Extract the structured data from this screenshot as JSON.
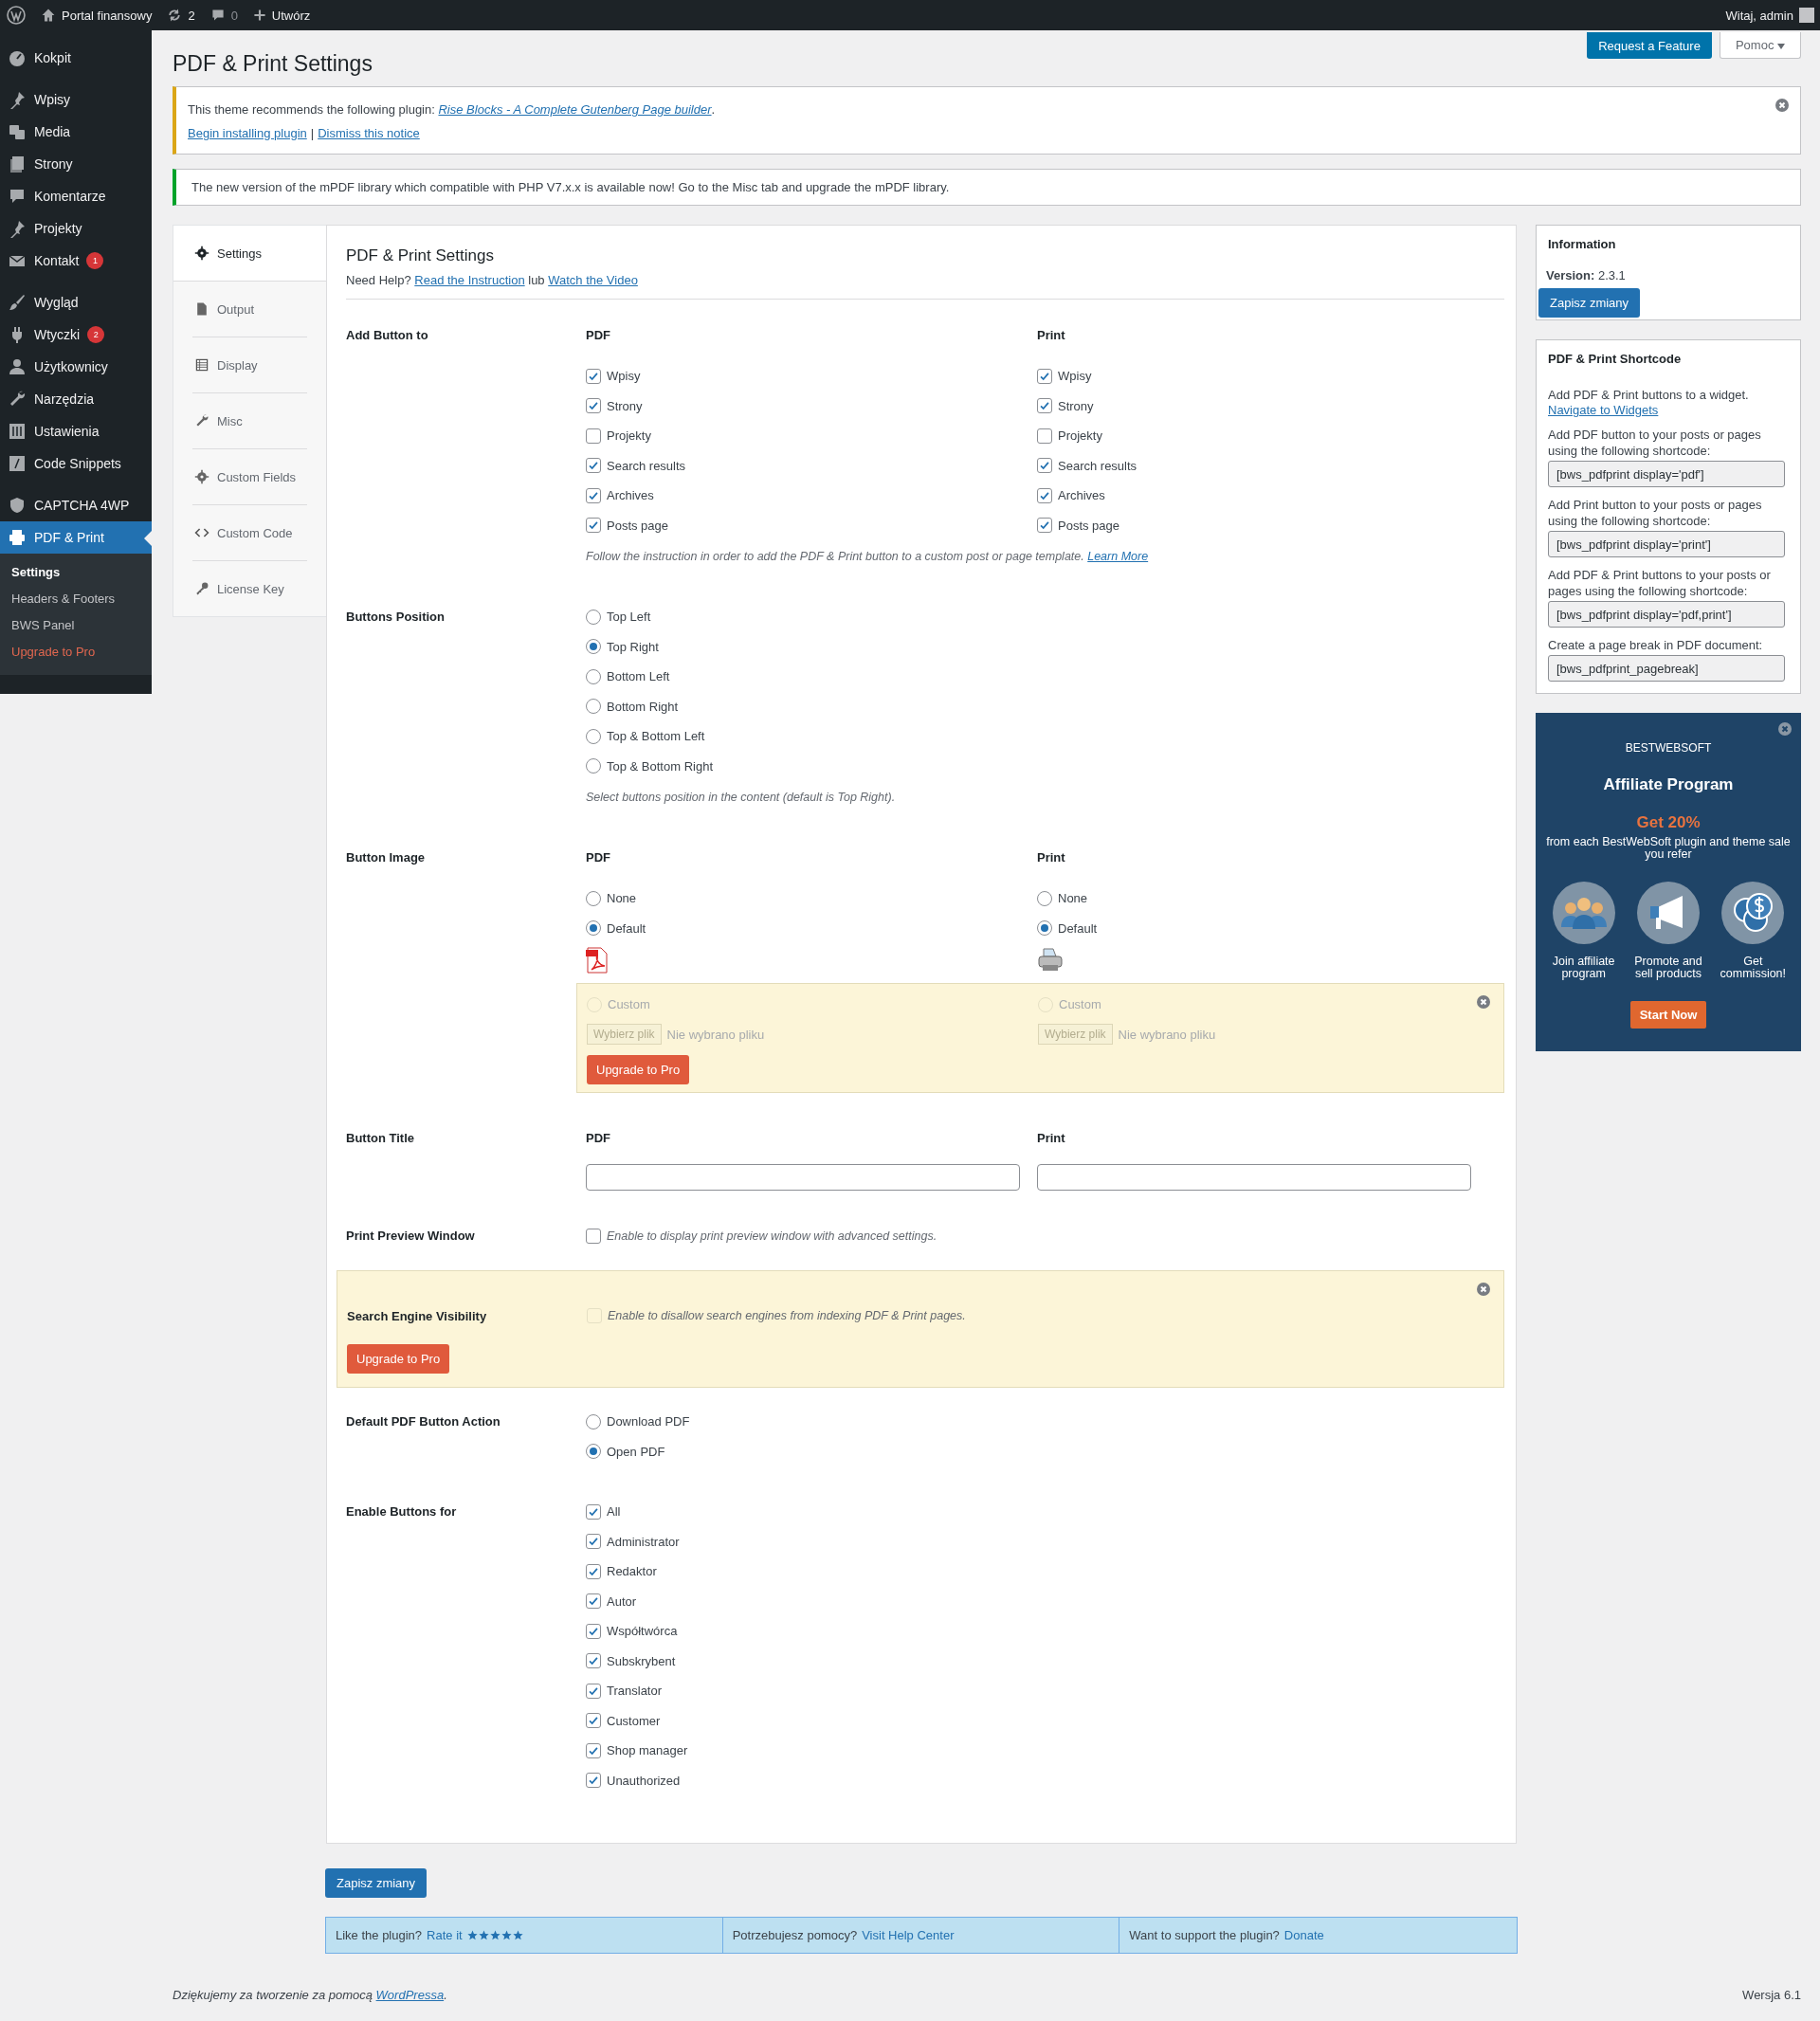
{
  "top_bar": {
    "site_name": "Portal finansowy",
    "updates": "2",
    "comments": "0",
    "new_label": "Utwórz",
    "greeting": "Witaj, admin"
  },
  "sidebar": {
    "groups": [
      {
        "items": [
          {
            "label": "Kokpit",
            "selected": false
          }
        ]
      },
      {
        "items": [
          {
            "label": "Wpisy",
            "selected": false
          },
          {
            "label": "Media",
            "selected": false
          },
          {
            "label": "Strony",
            "selected": false
          },
          {
            "label": "Komentarze",
            "selected": false
          },
          {
            "label": "Projekty",
            "selected": false
          },
          {
            "label": "Kontakt",
            "selected": false,
            "badge": "1"
          }
        ]
      },
      {
        "items": [
          {
            "label": "Wygląd",
            "selected": false
          },
          {
            "label": "Wtyczki",
            "selected": false,
            "badge": "2"
          },
          {
            "label": "Użytkownicy",
            "selected": false
          },
          {
            "label": "Narzędzia",
            "selected": false
          },
          {
            "label": "Ustawienia",
            "selected": false
          },
          {
            "label": "Code Snippets",
            "selected": false
          }
        ]
      },
      {
        "items": [
          {
            "label": "CAPTCHA 4WP",
            "selected": false
          },
          {
            "label": "PDF & Print",
            "selected": true
          }
        ]
      }
    ],
    "submenu": [
      {
        "label": "Settings",
        "selected": true,
        "kind": "link"
      },
      {
        "label": "Headers & Footers",
        "selected": false,
        "kind": "link"
      },
      {
        "label": "BWS Panel",
        "selected": false,
        "kind": "link"
      },
      {
        "label": "Upgrade to Pro",
        "selected": false,
        "kind": "upgrade"
      }
    ]
  },
  "header": {
    "title": "PDF & Print Settings",
    "feature_button": "Request a Feature",
    "help_button": "Pomoc"
  },
  "notices": [
    {
      "kind": "warning",
      "text": "This theme recommends the following plugin:",
      "plugin_link": "Rise Blocks - A Complete Gutenberg Page builder",
      "suffix": ".",
      "links": [
        "Begin installing plugin",
        "Dismiss this notice"
      ],
      "separator": "|"
    },
    {
      "kind": "success",
      "text": "The new version of the mPDF library which compatible with PHP V7.x.x is available now! Go to the Misc tab and upgrade the mPDF library."
    }
  ],
  "tabs": [
    {
      "label": "Settings",
      "selected": true
    },
    {
      "label": "Output",
      "selected": false
    },
    {
      "label": "Display",
      "selected": false
    },
    {
      "label": "Misc",
      "selected": false
    },
    {
      "label": "Custom Fields",
      "selected": false
    },
    {
      "label": "Custom Code",
      "selected": false
    },
    {
      "label": "License Key",
      "selected": false
    }
  ],
  "settings": {
    "title": "PDF & Print Settings",
    "help_prefix": "Need Help?",
    "help_links": [
      "Read the Instruction",
      "Watch the Video"
    ],
    "help_joiner": "lub",
    "add_buttons": {
      "label": "Add Button to",
      "columns": [
        {
          "heading": "PDF",
          "options": [
            {
              "label": "Wpisy",
              "checked": true
            },
            {
              "label": "Strony",
              "checked": true
            },
            {
              "label": "Projekty",
              "checked": false
            },
            {
              "label": "Search results",
              "checked": true
            },
            {
              "label": "Archives",
              "checked": true
            },
            {
              "label": "Posts page",
              "checked": true
            }
          ]
        },
        {
          "heading": "Print",
          "options": [
            {
              "label": "Wpisy",
              "checked": true
            },
            {
              "label": "Strony",
              "checked": true
            },
            {
              "label": "Projekty",
              "checked": false
            },
            {
              "label": "Search results",
              "checked": true
            },
            {
              "label": "Archives",
              "checked": true
            },
            {
              "label": "Posts page",
              "checked": true
            }
          ]
        }
      ],
      "note": "Follow the instruction in order to add the PDF & Print button to a custom post or page template.",
      "note_link": "Learn More"
    },
    "position": {
      "label": "Buttons Position",
      "options": [
        {
          "label": "Top Left",
          "selected": false
        },
        {
          "label": "Top Right",
          "selected": true
        },
        {
          "label": "Bottom Left",
          "selected": false
        },
        {
          "label": "Bottom Right",
          "selected": false
        },
        {
          "label": "Top & Bottom Left",
          "selected": false
        },
        {
          "label": "Top & Bottom Right",
          "selected": false
        }
      ],
      "note": "Select buttons position in the content (default is Top Right)."
    },
    "image": {
      "label": "Button Image",
      "columns": [
        {
          "heading": "PDF",
          "options": [
            {
              "label": "None",
              "selected": false
            },
            {
              "label": "Default",
              "selected": true
            }
          ]
        },
        {
          "heading": "Print",
          "options": [
            {
              "label": "None",
              "selected": false
            },
            {
              "label": "Default",
              "selected": true
            }
          ]
        }
      ],
      "pro": {
        "columns": [
          {
            "label": "Custom",
            "selected": false,
            "disabled": true,
            "file_button": "Wybierz plik",
            "file_status": "Nie wybrano pliku"
          },
          {
            "label": "Custom",
            "selected": false,
            "disabled": true,
            "file_button": "Wybierz plik",
            "file_status": "Nie wybrano pliku"
          }
        ],
        "upgrade_button": "Upgrade to Pro"
      }
    },
    "title_fields": {
      "label": "Button Title",
      "columns": [
        {
          "heading": "PDF"
        },
        {
          "heading": "Print"
        }
      ]
    },
    "preview": {
      "label": "Print Preview Window",
      "checked": false,
      "description": "Enable to display print preview window with advanced settings."
    },
    "search_visibility": {
      "label": "Search Engine Visibility",
      "checked": false,
      "disabled": true,
      "description": "Enable to disallow search engines from indexing PDF & Print pages.",
      "upgrade_button": "Upgrade to Pro"
    },
    "default_action": {
      "label": "Default PDF Button Action",
      "options": [
        {
          "label": "Download PDF",
          "selected": false
        },
        {
          "label": "Open PDF",
          "selected": true
        }
      ]
    },
    "enable_for": {
      "label": "Enable Buttons for",
      "options": [
        {
          "label": "All",
          "checked": true
        },
        {
          "label": "Administrator",
          "checked": true
        },
        {
          "label": "Redaktor",
          "checked": true
        },
        {
          "label": "Autor",
          "checked": true
        },
        {
          "label": "Współtwórca",
          "checked": true
        },
        {
          "label": "Subskrybent",
          "checked": true
        },
        {
          "label": "Translator",
          "checked": true
        },
        {
          "label": "Customer",
          "checked": true
        },
        {
          "label": "Shop manager",
          "checked": true
        },
        {
          "label": "Unauthorized",
          "checked": true
        }
      ]
    }
  },
  "save_button": "Zapisz zmiany",
  "info": {
    "title": "Information",
    "version_label": "Version:",
    "version": "2.3.1",
    "save_button": "Zapisz zmiany"
  },
  "shortcodes": {
    "title": "PDF & Print Shortcode",
    "intro": "Add PDF & Print buttons to a widget.",
    "link": "Navigate to Widgets",
    "items": [
      {
        "text": "Add PDF button to your posts or pages using the following shortcode:",
        "code": "[bws_pdfprint display='pdf']"
      },
      {
        "text": "Add Print button to your posts or pages using the following shortcode:",
        "code": "[bws_pdfprint display='print']"
      },
      {
        "text": "Add PDF & Print buttons to your posts or pages using the following shortcode:",
        "code": "[bws_pdfprint display='pdf,print']"
      },
      {
        "text": "Create a page break in PDF document:",
        "code": "[bws_pdfprint_pagebreak]"
      }
    ]
  },
  "banner": {
    "brand": "BESTWEBSOFT",
    "title": "Affiliate Program",
    "offer": "Get 20%",
    "subtitle": "from each BestWebSoft plugin and theme sale you refer",
    "steps": [
      "Join affiliate program",
      "Promote and sell products",
      "Get commission!"
    ],
    "button": "Start Now"
  },
  "support_bar": [
    {
      "text": "Like the plugin?",
      "link": "Rate it",
      "stars": 5
    },
    {
      "text": "Potrzebujesz pomocy?",
      "link": "Visit Help Center"
    },
    {
      "text": "Want to support the plugin?",
      "link": "Donate"
    }
  ],
  "footer": {
    "credit": "Dziękujemy za tworzenie za pomocą",
    "link": "WordPressa",
    "suffix": ".",
    "version": "Wersja 6.1"
  }
}
